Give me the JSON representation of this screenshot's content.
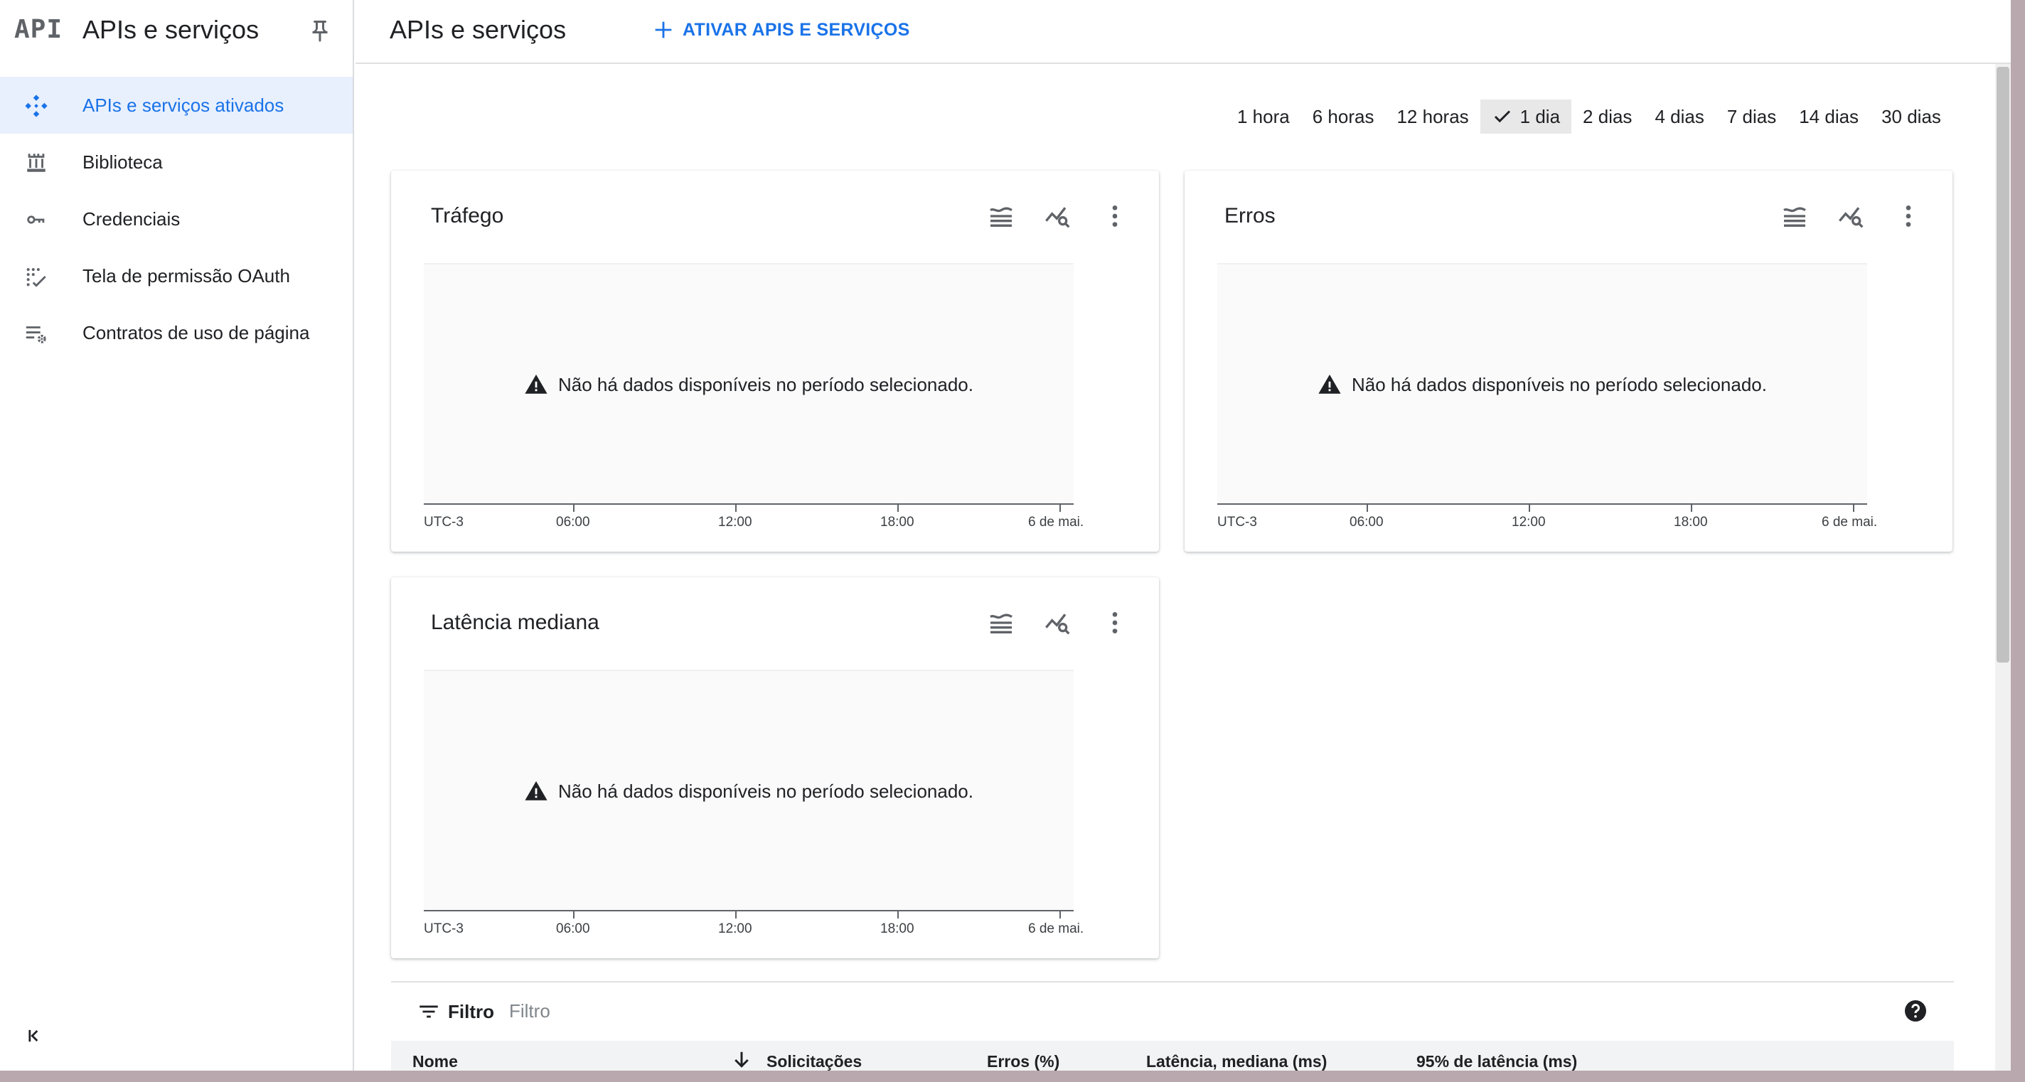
{
  "sidebar": {
    "logo": "API",
    "title": "APIs e serviços",
    "items": [
      {
        "label": "APIs e serviços ativados",
        "icon": "apis-diamond-icon",
        "active": true
      },
      {
        "label": "Biblioteca",
        "icon": "library-icon",
        "active": false
      },
      {
        "label": "Credenciais",
        "icon": "key-icon",
        "active": false
      },
      {
        "label": "Tela de permissão OAuth",
        "icon": "oauth-consent-icon",
        "active": false
      },
      {
        "label": "Contratos de uso de página",
        "icon": "page-usage-settings-icon",
        "active": false
      }
    ]
  },
  "header": {
    "title": "APIs e serviços",
    "enable_button": "ATIVAR APIS E SERVIÇOS"
  },
  "time_range": {
    "options": [
      "1 hora",
      "6 horas",
      "12 horas",
      "1 dia",
      "2 dias",
      "4 dias",
      "7 dias",
      "14 dias",
      "30 dias"
    ],
    "selected": "1 dia"
  },
  "charts": {
    "traffic": {
      "title": "Tráfego",
      "no_data": "Não há dados disponíveis no período selecionado.",
      "axis": [
        "UTC-3",
        "06:00",
        "12:00",
        "18:00",
        "6 de mai."
      ]
    },
    "errors": {
      "title": "Erros",
      "no_data": "Não há dados disponíveis no período selecionado.",
      "axis": [
        "UTC-3",
        "06:00",
        "12:00",
        "18:00",
        "6 de mai."
      ]
    },
    "latency": {
      "title": "Latência mediana",
      "no_data": "Não há dados disponíveis no período selecionado.",
      "axis": [
        "UTC-3",
        "06:00",
        "12:00",
        "18:00",
        "6 de mai."
      ]
    }
  },
  "table": {
    "filter_label": "Filtro",
    "filter_placeholder": "Filtro",
    "columns": [
      "Nome",
      "Solicitações",
      "Erros (%)",
      "Latência, mediana (ms)",
      "95% de latência (ms)"
    ]
  },
  "colors": {
    "accent": "#1a73e8",
    "active_bg": "#e8f0fe",
    "text": "#202124",
    "icon": "#5f6368"
  }
}
